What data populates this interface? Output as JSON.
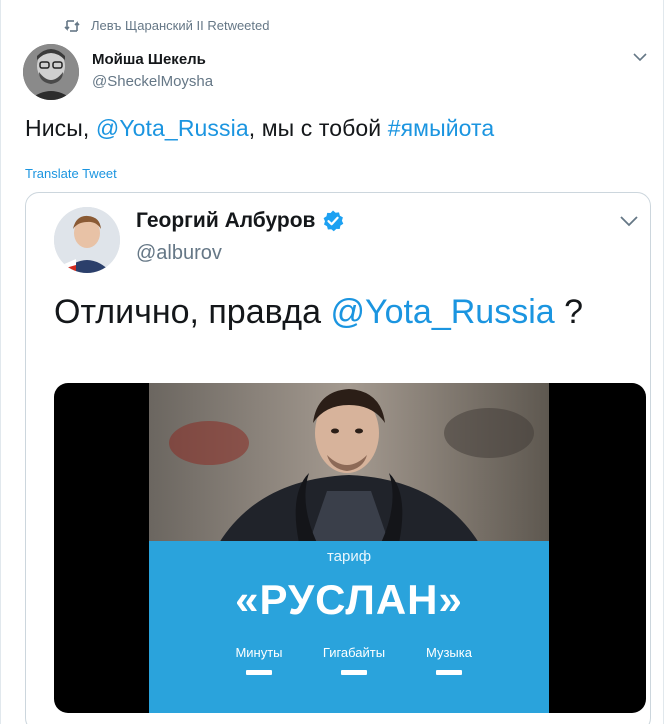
{
  "retweet": {
    "text": "Левъ Щаранский II Retweeted",
    "icon": "retweet-icon"
  },
  "author": {
    "name": "Мойша Шекель",
    "handle": "@SheckelMoysha"
  },
  "tweet": {
    "text_prefix": "Нисы, ",
    "mention": "@Yota_Russia",
    "text_middle": ", мы с тобой ",
    "hashtag": "#ямыйота",
    "translate_label": "Translate Tweet"
  },
  "quoted": {
    "name": "Георгий Албуров",
    "handle": "@alburov",
    "text_prefix": "Отлично, правда ",
    "mention": "@Yota_Russia",
    "text_suffix": " ?",
    "verified": true
  },
  "media": {
    "tariff_label": "тариф",
    "tariff_name": "«РУСЛАН»",
    "features": [
      {
        "label": "Минуты"
      },
      {
        "label": "Гигабайты"
      },
      {
        "label": "Музыка"
      }
    ]
  },
  "colors": {
    "link": "#1b95e0",
    "panel_blue": "#2aa3dc",
    "secondary_text": "#657786"
  }
}
